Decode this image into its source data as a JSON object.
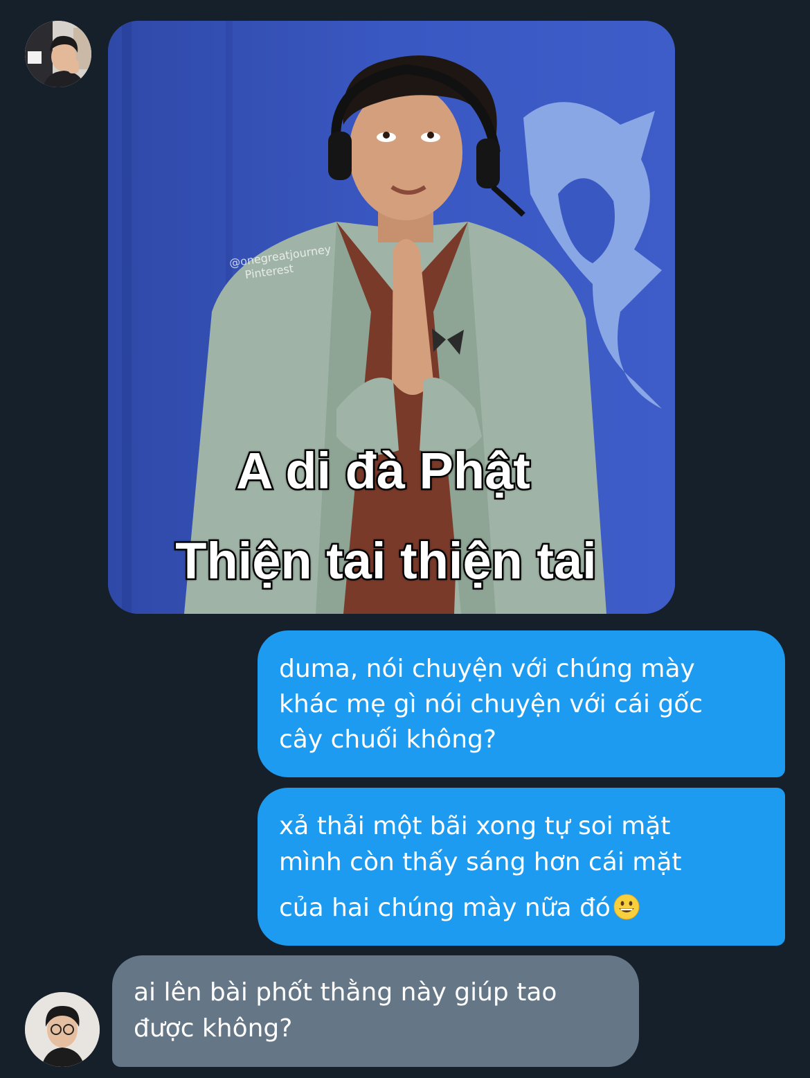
{
  "conversation": {
    "meme": {
      "caption_line1": "A di đà Phật",
      "caption_line2": "Thiện tai thiện tai",
      "watermark_line1": "@onegreatjourney",
      "watermark_line2": "Pinterest"
    },
    "sent_message_1": {
      "line1": "duma, nói chuyện với chúng mày",
      "line2": "khác mẹ gì nói chuyện với cái gốc",
      "line3": "cây chuối không?"
    },
    "sent_message_2": {
      "line1": "xả thải một bãi xong tự soi mặt",
      "line2": "mình còn thấy sáng hơn cái mặt",
      "line3": "của hai chúng mày nữa đó",
      "emoji": "grinning-face-emoji"
    },
    "received_message": {
      "line1": "ai lên bài phốt thằng này giúp tao",
      "line2": "được không?"
    }
  },
  "colors": {
    "background": "#15202b",
    "sent_bubble": "#1d9bf0",
    "received_bubble": "#657786",
    "text": "#ffffff",
    "meme_backdrop": "#3a55b8"
  }
}
